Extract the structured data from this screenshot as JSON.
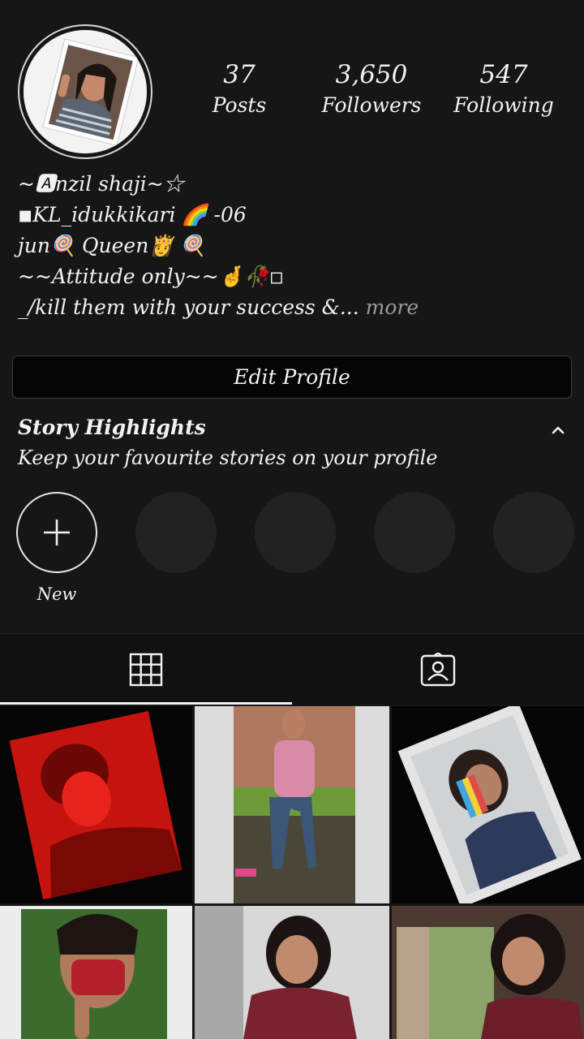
{
  "profile": {
    "stats": [
      {
        "count": "37",
        "label": "Posts"
      },
      {
        "count": "3,650",
        "label": "Followers"
      },
      {
        "count": "547",
        "label": "Following"
      }
    ],
    "bio": {
      "line1": "~🅰nzil shaji~☆",
      "line2": "◾KL_idukkikari 🌈 -06",
      "line3": "jun🍭  Queen👸 🍭",
      "line4": "~~Attitude  only~~🤞🥀◽",
      "line5": "_/kill them with your success &...",
      "more": " more"
    },
    "edit_profile_label": "Edit Profile"
  },
  "highlights": {
    "title": "Story Highlights",
    "subtitle": "Keep your favourite stories on your profile",
    "new_label": "New"
  },
  "tabs": [
    {
      "icon": "grid-icon",
      "active": true
    },
    {
      "icon": "tagged-icon",
      "active": false
    }
  ],
  "colors": {
    "background": "#161616",
    "text": "#f2f2f2",
    "muted": "#9a9a9a",
    "button_border": "#3d3d3d"
  }
}
